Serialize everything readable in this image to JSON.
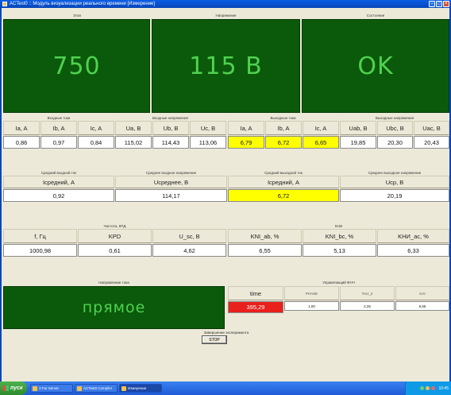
{
  "window": {
    "title": "ACTest0 :: Модуль визуализации реального времени [Измерение]"
  },
  "top_panels": [
    {
      "caption": "Этап",
      "value": "750"
    },
    {
      "caption": "Напряжение",
      "value": "115 В"
    },
    {
      "caption": "Состояние",
      "value": "OK"
    }
  ],
  "row1": {
    "groups": [
      "Входные токи",
      "Входные напряжения",
      "Выходные токи",
      "Выходные напряжения"
    ],
    "cells": [
      {
        "label": "Ia, A",
        "value": "0,86",
        "highlight": false
      },
      {
        "label": "Ib, A",
        "value": "0,97",
        "highlight": false
      },
      {
        "label": "Ic, A",
        "value": "0,84",
        "highlight": false
      },
      {
        "label": "Ua, B",
        "value": "115,02",
        "highlight": false
      },
      {
        "label": "Ub, B",
        "value": "114,43",
        "highlight": false
      },
      {
        "label": "Uc, B",
        "value": "113,06",
        "highlight": false
      },
      {
        "label": "Ia, A",
        "value": "6,79",
        "highlight": true
      },
      {
        "label": "Ib, A",
        "value": "6,72",
        "highlight": true
      },
      {
        "label": "Ic, A",
        "value": "6,65",
        "highlight": true
      },
      {
        "label": "Uab, B",
        "value": "19,85",
        "highlight": false
      },
      {
        "label": "Ubc, B",
        "value": "20,30",
        "highlight": false
      },
      {
        "label": "Uac, B",
        "value": "20,43",
        "highlight": false
      }
    ]
  },
  "row2": {
    "cells": [
      {
        "caption": "Средний входной ток",
        "label": "Iсредний, A",
        "value": "0,92",
        "highlight": false
      },
      {
        "caption": "Среднее входное напряжение",
        "label": "Uсреднее, B",
        "value": "114,17",
        "highlight": false
      },
      {
        "caption": "Средний выходной ток",
        "label": "Iсредний, A",
        "value": "6,72",
        "highlight": true
      },
      {
        "caption": "Среднее выходное напряжение",
        "label": "Uср, B",
        "value": "20,19",
        "highlight": false
      }
    ]
  },
  "row3": {
    "groups": [
      "Частота, КПД",
      "КНИ"
    ],
    "cells": [
      {
        "label": "f, Гц",
        "value": "1000,98"
      },
      {
        "label": "KPD",
        "value": "0,61"
      },
      {
        "label": "U_sc, B",
        "value": "4,62"
      },
      {
        "label": "KNI_ab, %",
        "value": "6,55"
      },
      {
        "label": "KNI_bc, %",
        "value": "5,13"
      },
      {
        "label": "KНИ_ac, %",
        "value": "6,33"
      }
    ]
  },
  "bottom": {
    "panel_caption": "Направление тока",
    "panel_value": "прямое",
    "table_caption": "Управляющий ФНЧ",
    "time_label": "time",
    "time_value": "395,29",
    "columns": [
      {
        "label": "PHASE",
        "value": "1,00"
      },
      {
        "label": "TAU_2",
        "value": "2,25"
      },
      {
        "label": "KAI",
        "value": "6,55"
      }
    ],
    "stop_caption": "Завершение эксперимента",
    "stop_label": "STOP"
  },
  "taskbar": {
    "start_label": "пуск",
    "tasks": [
      "3 Far Server",
      "ACTest0 Compiler",
      "Измерение"
    ],
    "clock": "10:45"
  },
  "colors": {
    "panel_bg": "#0b5a0b",
    "panel_text": "#4fd24f",
    "highlight": "#ffff00",
    "alarm": "#e8211c"
  }
}
